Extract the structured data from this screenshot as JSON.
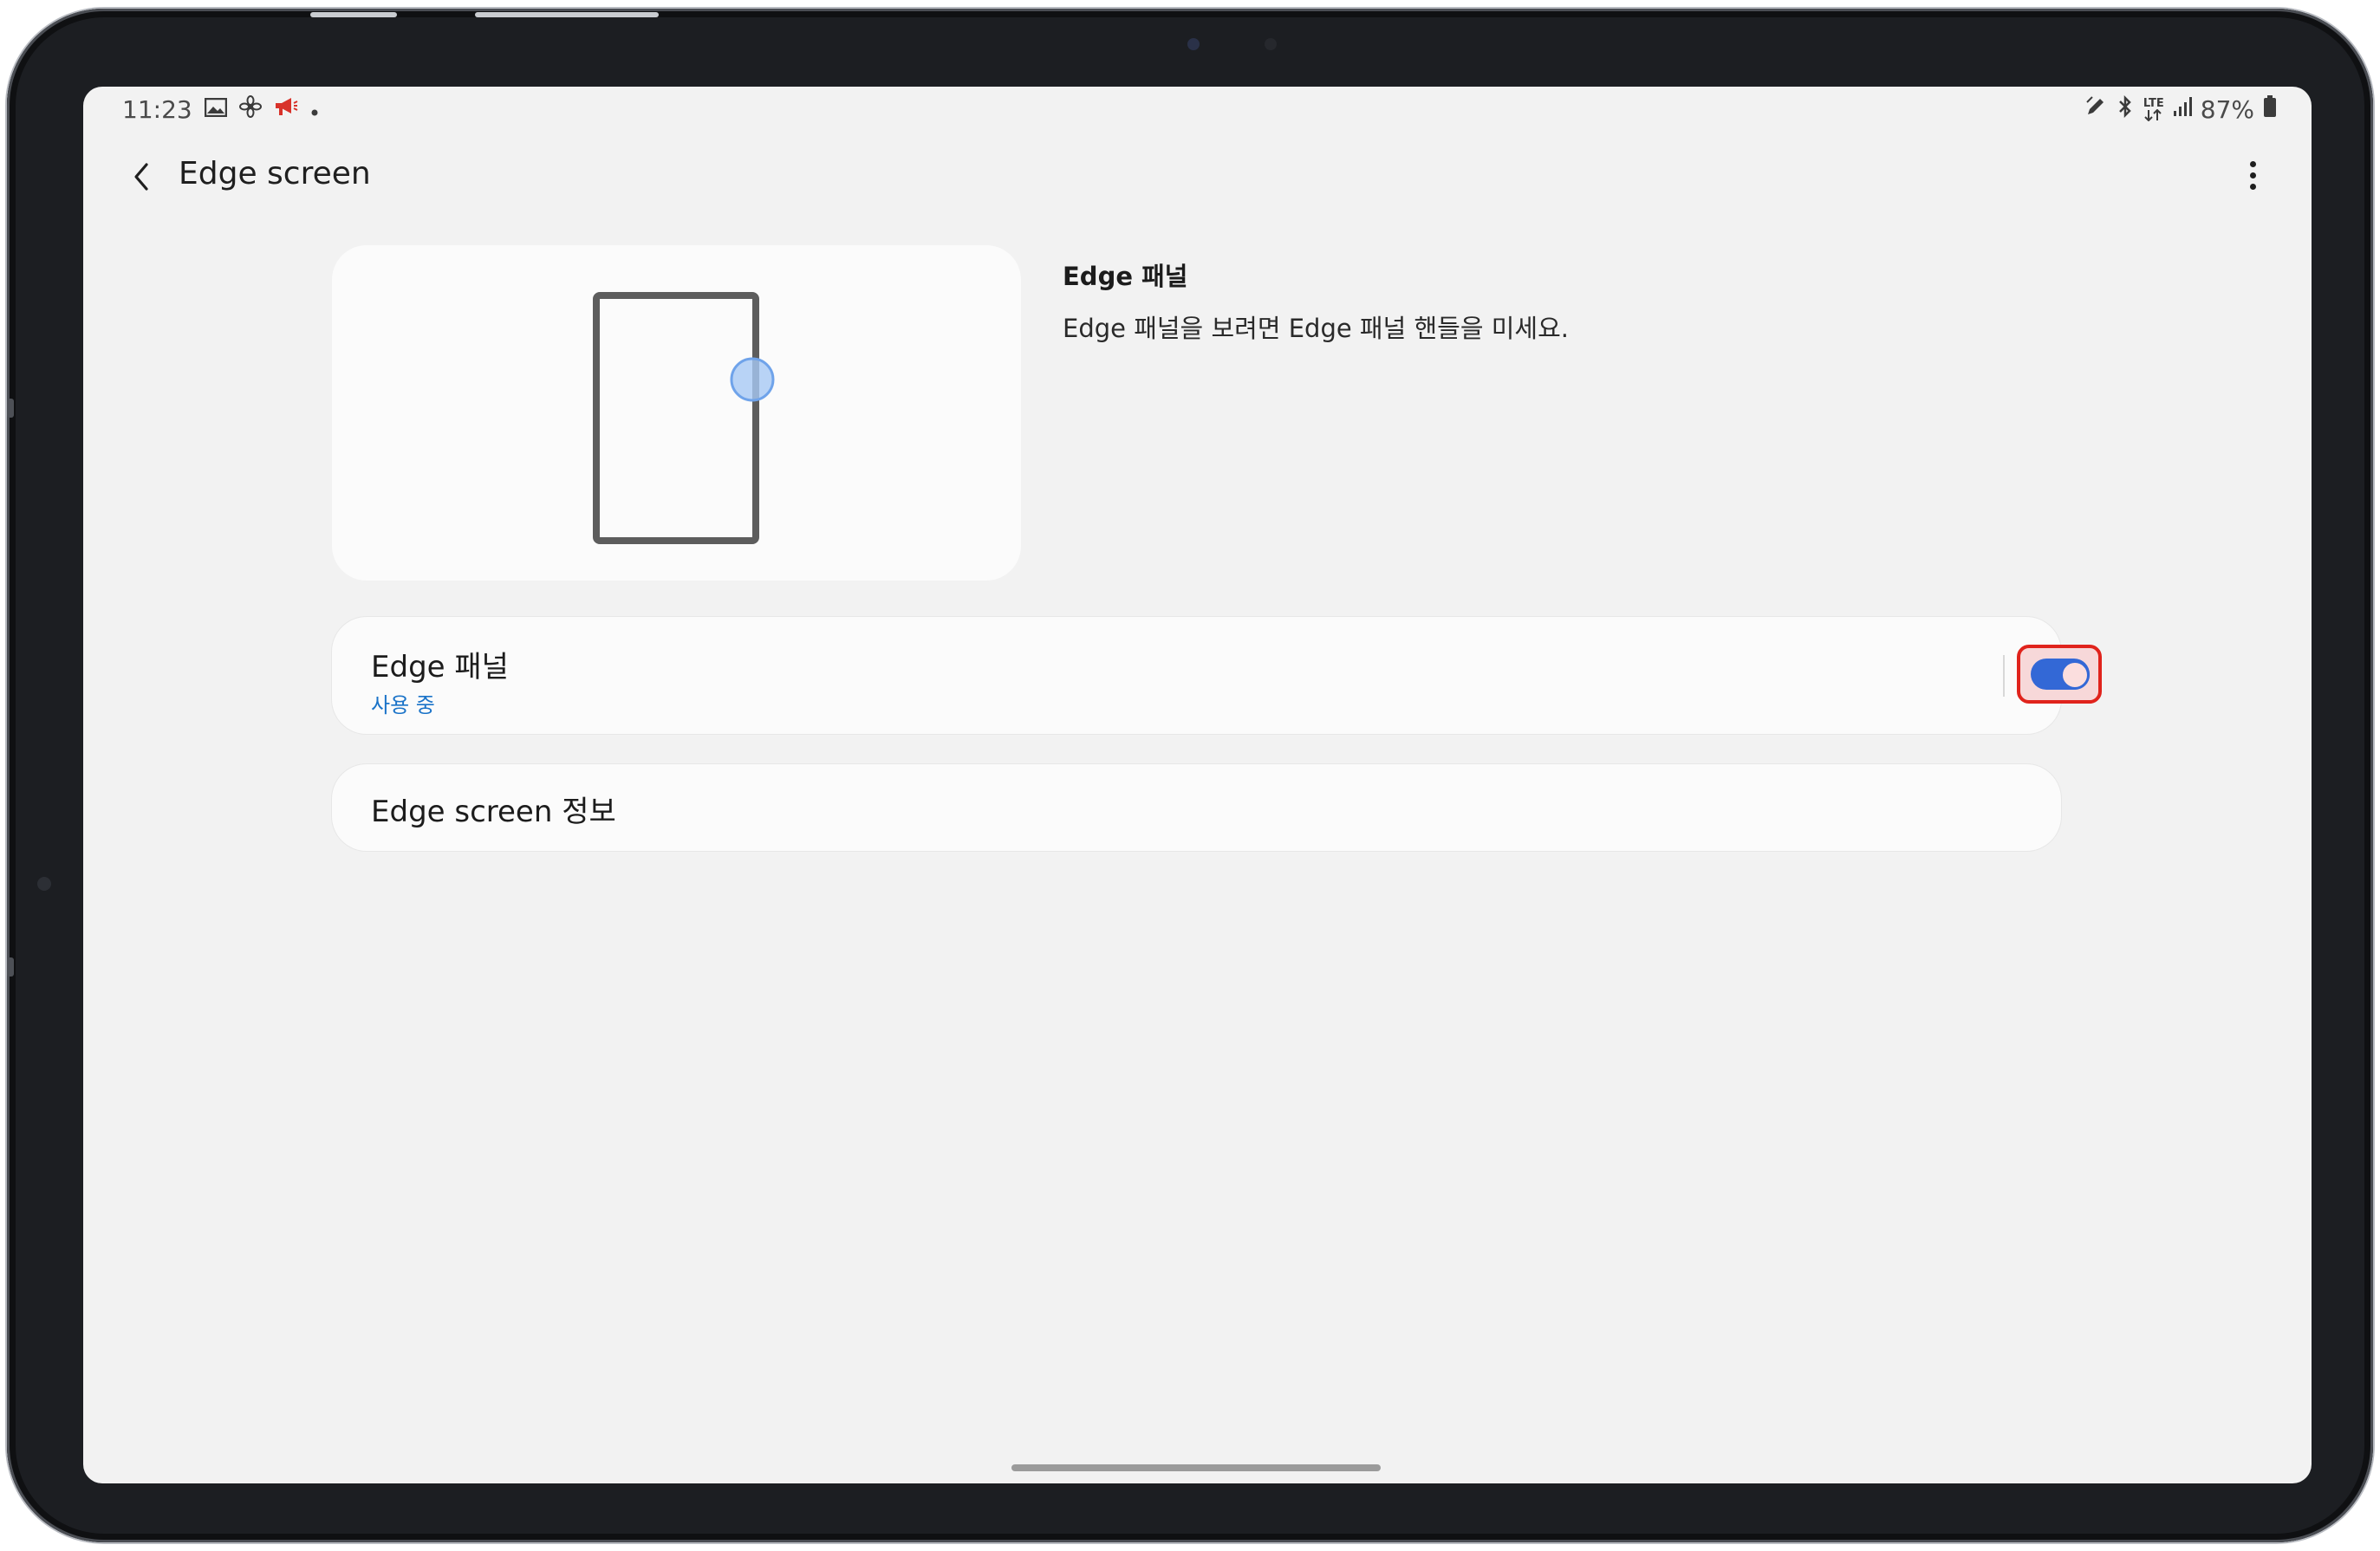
{
  "status_bar": {
    "time": "11:23",
    "icons_left": [
      "gallery-icon",
      "fan-icon",
      "megaphone-icon",
      "dot-icon"
    ],
    "icons_right": [
      "pen-icon",
      "bluetooth-icon",
      "lte-icon",
      "signal-icon"
    ],
    "lte_label": "LTE",
    "battery": "87%"
  },
  "header": {
    "title": "Edge screen"
  },
  "preview_info": {
    "heading": "Edge 패널",
    "description": "Edge 패널을 보려면 Edge 패널 핸들을 미세요."
  },
  "edge_panel_setting": {
    "label": "Edge 패널",
    "status": "사용 중",
    "enabled": true
  },
  "about": {
    "label": "Edge screen 정보"
  },
  "colors": {
    "accent": "#3368d6",
    "status_text": "#1a73c8",
    "highlight_border": "#e0231c",
    "screen_background": "#f2f2f2"
  }
}
